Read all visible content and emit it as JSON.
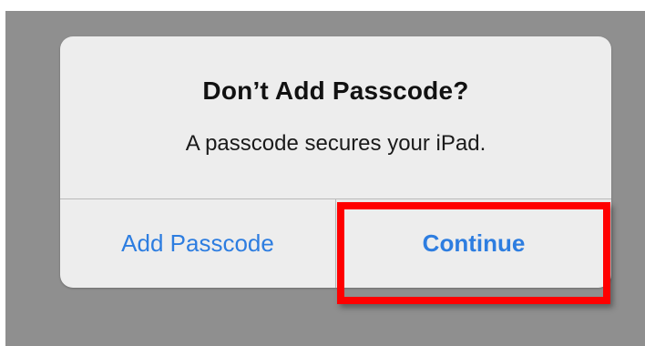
{
  "alert": {
    "title": "Don’t Add Passcode?",
    "message": "A passcode secures your iPad.",
    "buttons": {
      "add_passcode": "Add Passcode",
      "continue": "Continue"
    }
  },
  "colors": {
    "backdrop": "#8f8f8f",
    "alert_background": "#ededed",
    "button_text": "#2d7de0",
    "highlight": "#ff0000"
  }
}
